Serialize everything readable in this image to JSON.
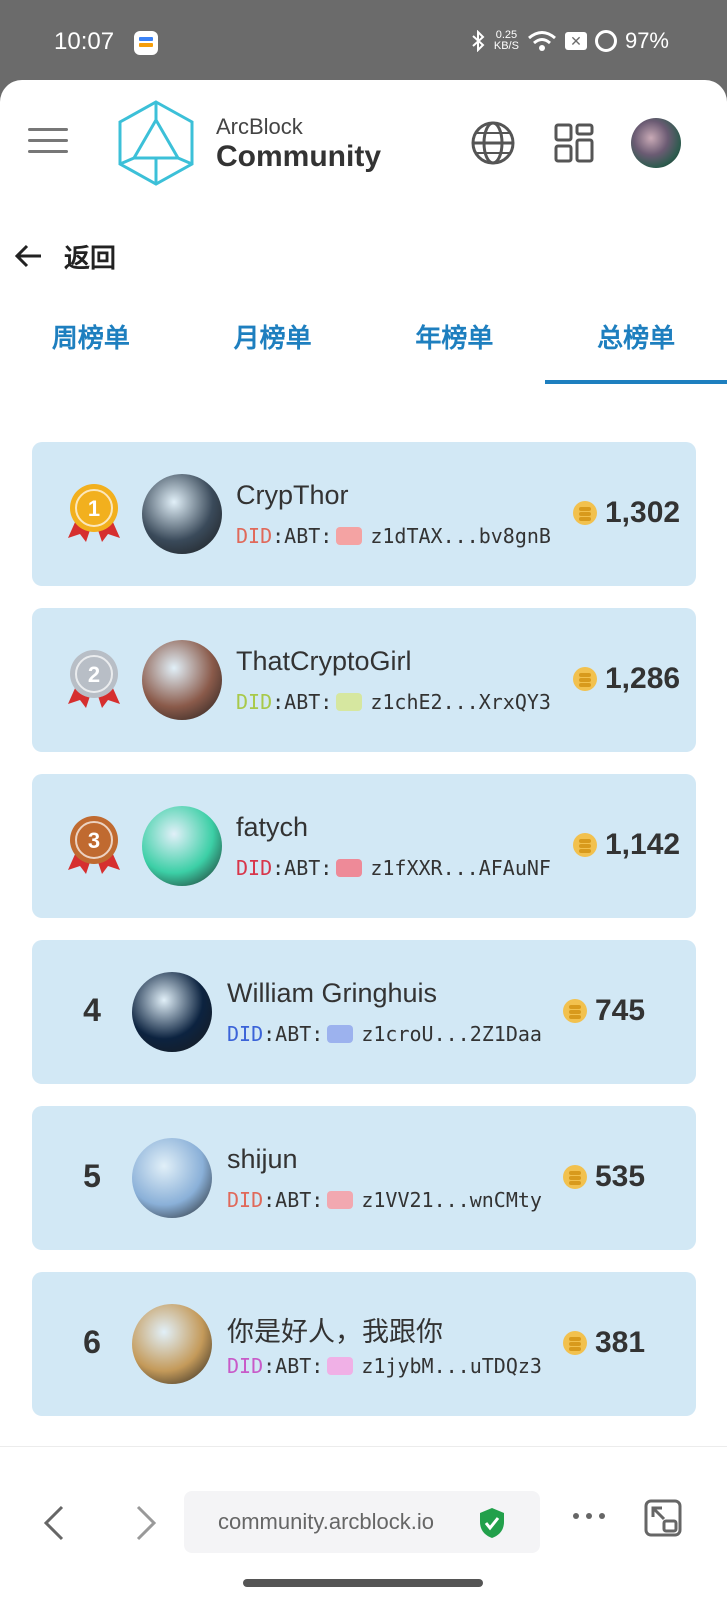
{
  "status_bar": {
    "time": "10:07",
    "net_speed_value": "0.25",
    "net_speed_unit": "KB/S",
    "battery": "97%"
  },
  "header": {
    "brand_top": "ArcBlock",
    "brand_main": "Community"
  },
  "back": {
    "label": "返回"
  },
  "tabs": [
    {
      "label": "周榜单",
      "active": false
    },
    {
      "label": "月榜单",
      "active": false
    },
    {
      "label": "年榜单",
      "active": false
    },
    {
      "label": "总榜单",
      "active": true
    }
  ],
  "leaderboard": [
    {
      "rank": "1",
      "name": "CrypThor",
      "did_prefix": "DID",
      "did_suffix": ":ABT:",
      "did_short": "z1dTAX...bv8gnB",
      "score": "1,302",
      "did_color": "#e0695a",
      "did_icon_color": "#f4a3a3",
      "avatar_color": "#3a4a5a",
      "medal_color": "#f2b01e"
    },
    {
      "rank": "2",
      "name": "ThatCryptoGirl",
      "did_prefix": "DID",
      "did_suffix": ":ABT:",
      "did_short": "z1chE2...XrxQY3",
      "score": "1,286",
      "did_color": "#a8c94a",
      "did_icon_color": "#d6e7a0",
      "avatar_color": "#8a5a4a",
      "medal_color": "#b8bec6"
    },
    {
      "rank": "3",
      "name": "fatych",
      "did_prefix": "DID",
      "did_suffix": ":ABT:",
      "did_short": "z1fXXR...AFAuNF",
      "score": "1,142",
      "did_color": "#d8364a",
      "did_icon_color": "#ee8a98",
      "avatar_color": "#3ccfa6",
      "medal_color": "#c06a30"
    },
    {
      "rank": "4",
      "name": "William Gringhuis",
      "did_prefix": "DID",
      "did_suffix": ":ABT:",
      "did_short": "z1croU...2Z1Daa",
      "score": "745",
      "did_color": "#3b63d8",
      "did_icon_color": "#9cb2ee",
      "avatar_color": "#0c2340",
      "medal_color": ""
    },
    {
      "rank": "5",
      "name": "shijun",
      "did_prefix": "DID",
      "did_suffix": ":ABT:",
      "did_short": "z1VV21...wnCMty",
      "score": "535",
      "did_color": "#e0695a",
      "did_icon_color": "#f2a8b0",
      "avatar_color": "#8ab0d8",
      "medal_color": ""
    },
    {
      "rank": "6",
      "name": "你是好人，我跟你",
      "did_prefix": "DID",
      "did_suffix": ":ABT:",
      "did_short": "z1jybM...uTDQz3",
      "score": "381",
      "did_color": "#c85ac8",
      "did_icon_color": "#f0b0e6",
      "avatar_color": "#c49a5a",
      "medal_color": ""
    }
  ],
  "browser": {
    "url": "community.arcblock.io"
  },
  "colors": {
    "accent": "#1e7fbf",
    "row_bg": "#d2e8f5",
    "coin": "#f2c14e"
  }
}
